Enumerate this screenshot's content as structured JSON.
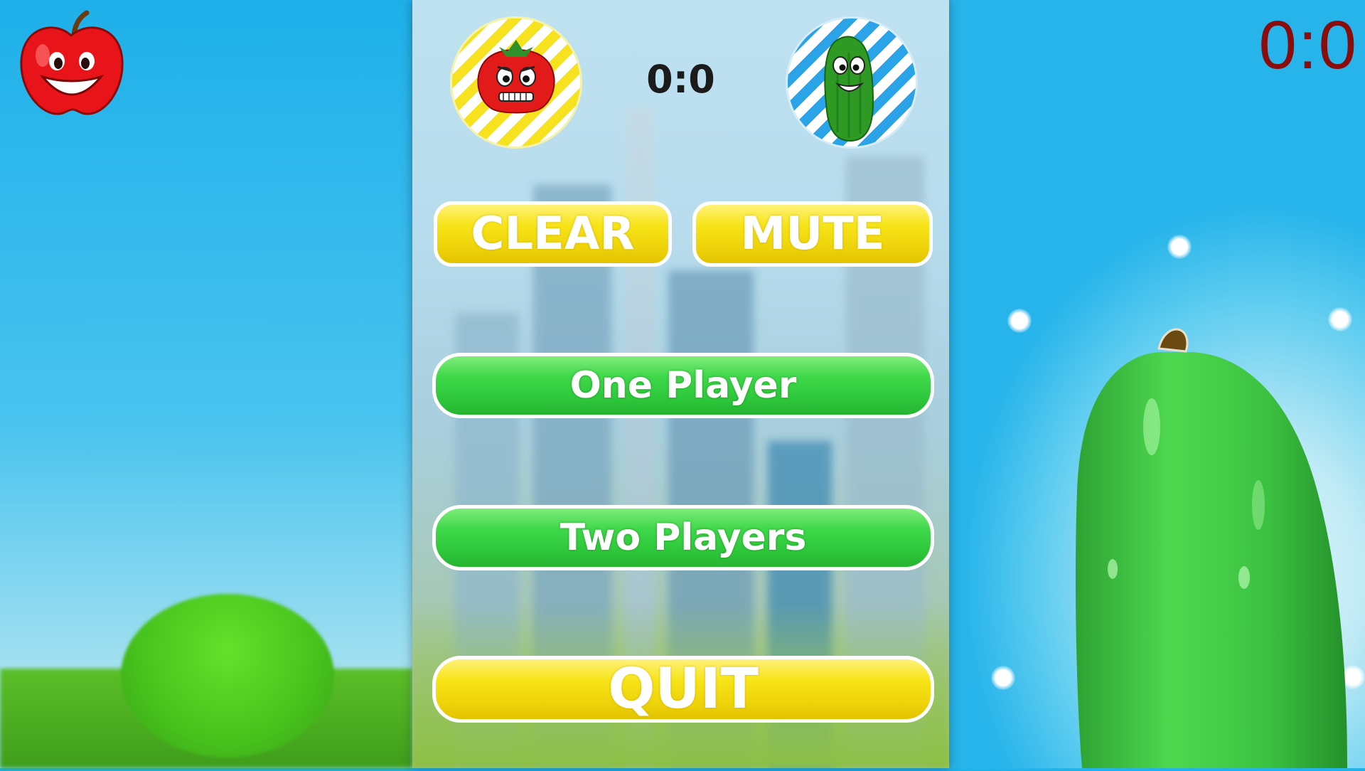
{
  "hud": {
    "corner_score": "0:0"
  },
  "menu": {
    "score": "0:0",
    "clear_label": "CLEAR",
    "mute_label": "MUTE",
    "one_player_label": "One Player",
    "two_players_label": "Two Players",
    "quit_label": "QUIT"
  },
  "icons": {
    "top_left": "apple-icon",
    "player1_avatar": "tomato-icon",
    "player2_avatar": "cucumber-icon"
  },
  "colors": {
    "yellow_button": "#f7e418",
    "green_button": "#3fd84a",
    "corner_score": "#8b0c0c",
    "sky": "#1bb3ea"
  }
}
